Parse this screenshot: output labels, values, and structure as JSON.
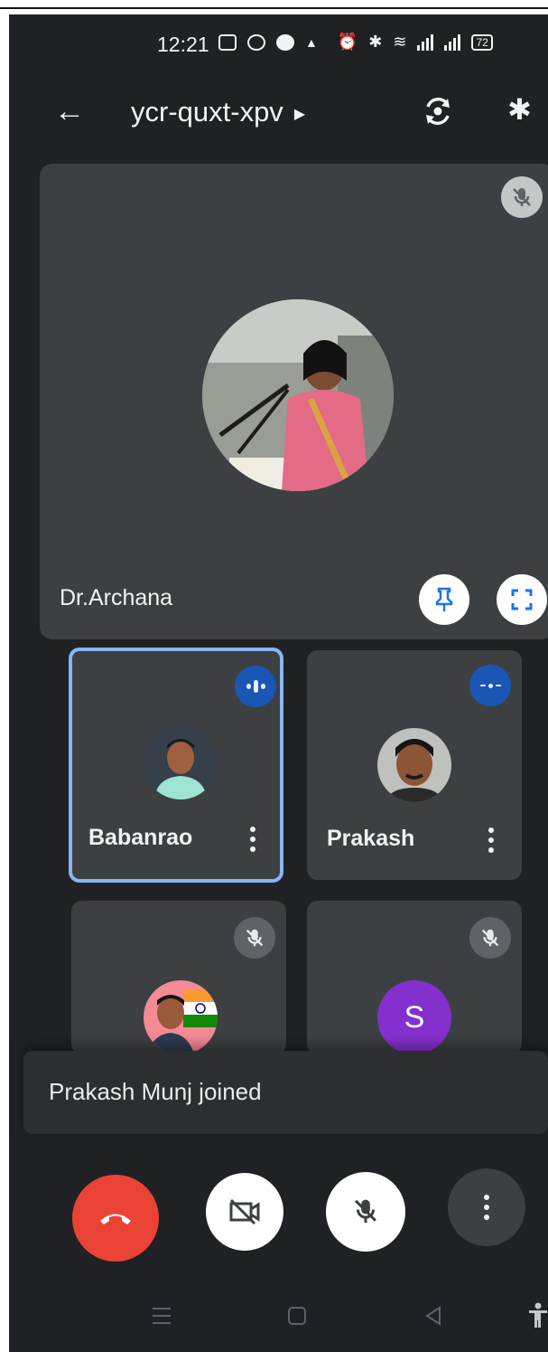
{
  "status_bar": {
    "time": "12:21",
    "battery": "72"
  },
  "app_bar": {
    "meeting_code": "ycr-quxt-xpv",
    "back_icon": "arrow-left-icon",
    "switch_camera_icon": "switch-camera-icon",
    "bluetooth_icon": "bluetooth-icon"
  },
  "main_tile": {
    "name": "Dr.Archana",
    "muted": true
  },
  "tiles": [
    {
      "name": "Babanrao",
      "speaking": true,
      "active": true
    },
    {
      "name": "Prakash",
      "speaking": true,
      "active": false
    },
    {
      "name": "",
      "muted": true
    },
    {
      "name": "",
      "muted": true,
      "initial": "S"
    }
  ],
  "toast": {
    "text": "Prakash Munj joined"
  },
  "controls": {
    "end_call_icon": "phone-hangup-icon",
    "camera_icon": "camera-off-icon",
    "mic_icon": "mic-off-icon",
    "more_icon": "more-vert-icon"
  },
  "colors": {
    "background": "#202124",
    "tile": "#3c4043",
    "end_call": "#ea4335",
    "active_border": "#8ab4f8",
    "speaking_badge": "#1a56b3",
    "avatar_s": "#8430ce"
  }
}
